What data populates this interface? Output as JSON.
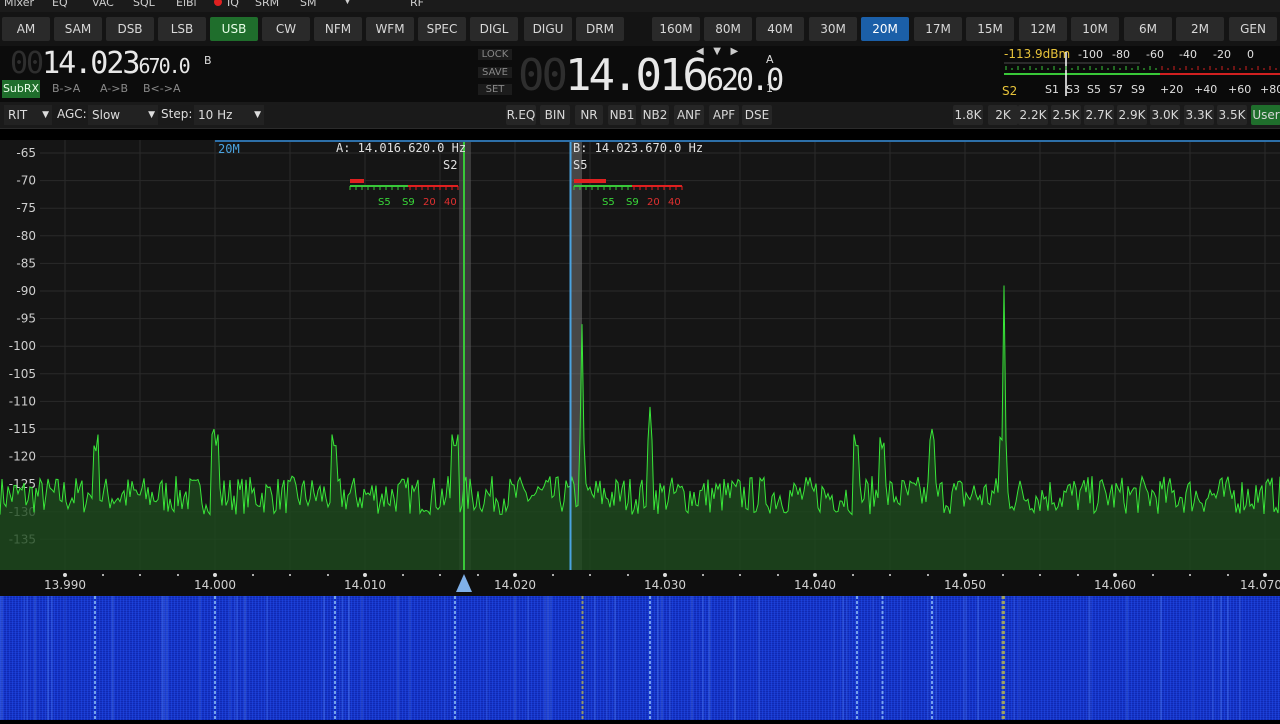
{
  "top_menu": [
    "Mixer",
    "EQ",
    "VAC",
    "SQL",
    "EiBi",
    "IQ",
    "SRM",
    "SM",
    "RF"
  ],
  "modes": [
    {
      "label": "AM",
      "active": false
    },
    {
      "label": "SAM",
      "active": false
    },
    {
      "label": "DSB",
      "active": false
    },
    {
      "label": "LSB",
      "active": false
    },
    {
      "label": "USB",
      "active": true
    },
    {
      "label": "CW",
      "active": false
    },
    {
      "label": "NFM",
      "active": false
    },
    {
      "label": "WFM",
      "active": false
    },
    {
      "label": "SPEC",
      "active": false
    },
    {
      "label": "DIGL",
      "active": false
    },
    {
      "label": "DIGU",
      "active": false
    },
    {
      "label": "DRM",
      "active": false
    }
  ],
  "bands": [
    {
      "label": "160M",
      "active": false
    },
    {
      "label": "80M",
      "active": false
    },
    {
      "label": "40M",
      "active": false
    },
    {
      "label": "30M",
      "active": false
    },
    {
      "label": "20M",
      "active": true
    },
    {
      "label": "17M",
      "active": false
    },
    {
      "label": "15M",
      "active": false
    },
    {
      "label": "12M",
      "active": false
    },
    {
      "label": "10M",
      "active": false
    },
    {
      "label": "6M",
      "active": false
    },
    {
      "label": "2M",
      "active": false
    },
    {
      "label": "GEN",
      "active": false
    }
  ],
  "vfo_b": {
    "dim_digits": "00",
    "main": "14.023",
    "fine": "670.0",
    "label": "B"
  },
  "vfo_a": {
    "dim_digits": "00",
    "main": "14.016",
    "fine": "620.0",
    "label": "A",
    "sub": "1"
  },
  "sub_buttons": {
    "subrx": "SubRX",
    "b_to_a": "B->A",
    "a_to_b": "A->B",
    "swap": "B<->A"
  },
  "lock_buttons": {
    "lock": "LOCK",
    "save": "SAVE",
    "set": "SET"
  },
  "meter": {
    "dbm": "-113.9dBm",
    "top_scale": [
      "-100",
      "-80",
      "-60",
      "-40",
      "-20",
      "0"
    ],
    "bottom_scale": [
      "S1",
      "S3",
      "S5",
      "S7",
      "S9",
      "+20",
      "+40",
      "+60",
      "+80"
    ],
    "s_reading": "S2"
  },
  "controls": {
    "rit": "RIT",
    "agc_label": "AGC:",
    "agc_value": "Slow",
    "step_label": "Step:",
    "step_value": "10 Hz",
    "dsp": [
      "R.EQ",
      "BIN",
      "NR",
      "NB1",
      "NB2",
      "ANF",
      "APF",
      "DSE"
    ],
    "filters": [
      {
        "label": "1.8K",
        "active": false
      },
      {
        "label": "2K",
        "active": false
      },
      {
        "label": "2.2K",
        "active": false
      },
      {
        "label": "2.5K",
        "active": false
      },
      {
        "label": "2.7K",
        "active": false
      },
      {
        "label": "2.9K",
        "active": false
      },
      {
        "label": "3.0K",
        "active": false
      },
      {
        "label": "3.3K",
        "active": false
      },
      {
        "label": "3.5K",
        "active": false
      },
      {
        "label": "User",
        "active": true
      }
    ]
  },
  "spectrum": {
    "band_label": "20M",
    "rx_a_label": "A: 14.016.620.0 Hz",
    "rx_a_s": "S2",
    "rx_b_label": "B: 14.023.670.0 Hz",
    "rx_b_s": "S5",
    "meter_scale": [
      "S5",
      "S9",
      "20",
      "40"
    ],
    "y_labels": [
      "-65",
      "-70",
      "-75",
      "-80",
      "-85",
      "-90",
      "-95",
      "-100",
      "-105",
      "-110",
      "-115",
      "-120",
      "-125",
      "-130",
      "-135"
    ],
    "x_labels": [
      "13.990",
      "14.000",
      "14.010",
      "14.020",
      "14.030",
      "14.040",
      "14.050",
      "14.060",
      "14.070"
    ],
    "peaks_mhz": [
      13.992,
      14.0,
      14.008,
      14.016,
      14.0245,
      14.029,
      14.0428,
      14.0445,
      14.0478,
      14.0526,
      14.0525
    ],
    "colors": {
      "trace": "#39e639",
      "fill": "#1d4a1d",
      "grid": "#2a2a2a",
      "rx_a": "#39c839",
      "rx_b": "#4aa3e0",
      "accent": "#e02020"
    }
  }
}
